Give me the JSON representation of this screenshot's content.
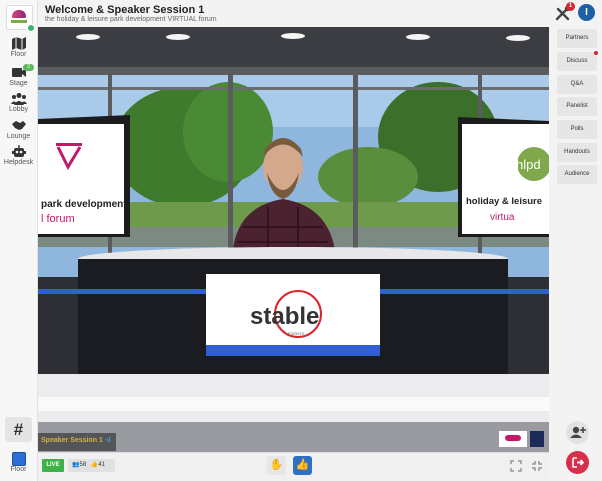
{
  "header": {
    "title": "Welcome & Speaker Session 1",
    "subtitle": "the holiday & leisure park development VIRTUAL forum",
    "notifications_count": "1",
    "user_initial": "I"
  },
  "nav": {
    "items": [
      {
        "label": "Floor",
        "icon": "map-icon"
      },
      {
        "label": "Stage",
        "icon": "video-camera-icon",
        "badge": "3"
      },
      {
        "label": "Lobby",
        "icon": "people-icon"
      },
      {
        "label": "Lounge",
        "icon": "handshake-icon"
      },
      {
        "label": "Helpdesk",
        "icon": "robot-icon"
      }
    ],
    "hash_label": "#",
    "bottom_label": "Floor"
  },
  "tabs": [
    "Partners",
    "Discuss",
    "Q&A",
    "Panelist",
    "Polls",
    "Handouts",
    "Audience"
  ],
  "video": {
    "session_label": "Speaker Session 1",
    "left_screen": [
      "park development",
      "l forum"
    ],
    "right_screen_logo": "hlpd",
    "right_screen": [
      "holiday & leisure",
      "virtua"
    ],
    "desk_brand": "stable",
    "desk_brand_sub": "EVENTS"
  },
  "bottom_bar": {
    "live_label": "LIVE",
    "attendees": "58",
    "likes": "41"
  },
  "colors": {
    "accent_blue": "#1f5fa8",
    "live_green": "#3cb34a",
    "alert_red": "#d9262c",
    "brand_magenta": "#c2186a"
  }
}
